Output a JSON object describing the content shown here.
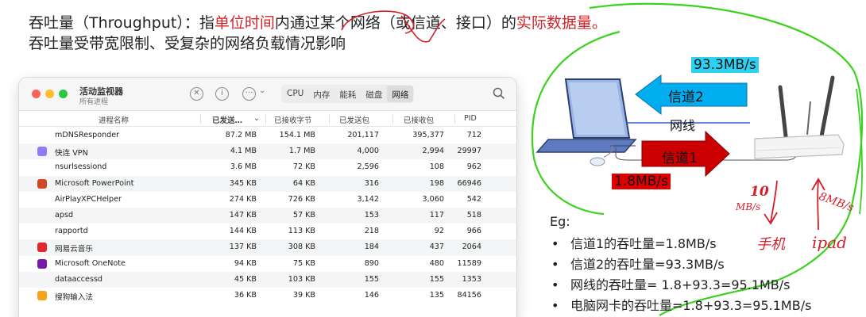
{
  "heading": {
    "line1_pre": "吞吐量（Throughput）：指",
    "line1_red1": "单位时间",
    "line1_mid": "内通过某个网络（或信道、接口）的",
    "line1_red2": "实际数据量",
    "line1_end": "。",
    "line2": "吞吐量受带宽限制、受复杂的网络负载情况影响"
  },
  "monitor": {
    "title": "活动监视器",
    "subtitle": "所有进程",
    "tabs": [
      "CPU",
      "内存",
      "能耗",
      "磁盘",
      "网络"
    ],
    "active_tab": "网络",
    "columns": {
      "name": "进程名称",
      "sent": "已发送…",
      "received": "已接收字节",
      "packets_in": "已发送包",
      "packets_out": "已接收包",
      "pid": "PID"
    },
    "rows": [
      {
        "name": "mDNSResponder",
        "sent": "87.2 MB",
        "received": "154.1 MB",
        "pin": "201,117",
        "pout": "395,377",
        "pid": "712",
        "icon": "none"
      },
      {
        "name": "快连 VPN",
        "sent": "4.1 MB",
        "received": "1.7 MB",
        "pin": "4,000",
        "pout": "2,994",
        "pid": "29997",
        "icon": "vpn-icon"
      },
      {
        "name": "nsurlsessiond",
        "sent": "3.6 MB",
        "received": "72 KB",
        "pin": "2,596",
        "pout": "108",
        "pid": "962",
        "icon": "none"
      },
      {
        "name": "Microsoft PowerPoint",
        "sent": "345 KB",
        "received": "64 KB",
        "pin": "316",
        "pout": "198",
        "pid": "66946",
        "icon": "powerpoint-icon"
      },
      {
        "name": "AirPlayXPCHelper",
        "sent": "274 KB",
        "received": "726 KB",
        "pin": "3,142",
        "pout": "3,060",
        "pid": "542",
        "icon": "none"
      },
      {
        "name": "apsd",
        "sent": "147 KB",
        "received": "57 KB",
        "pin": "153",
        "pout": "117",
        "pid": "518",
        "icon": "none"
      },
      {
        "name": "rapportd",
        "sent": "144 KB",
        "received": "113 KB",
        "pin": "218",
        "pout": "92",
        "pid": "966",
        "icon": "none"
      },
      {
        "name": "网易云音乐",
        "sent": "137 KB",
        "received": "308 KB",
        "pin": "184",
        "pout": "437",
        "pid": "2064",
        "icon": "netease-music-icon"
      },
      {
        "name": "Microsoft OneNote",
        "sent": "94 KB",
        "received": "75 KB",
        "pin": "890",
        "pout": "480",
        "pid": "11589",
        "icon": "onenote-icon"
      },
      {
        "name": "dataaccessd",
        "sent": "45 KB",
        "received": "103 KB",
        "pin": "155",
        "pout": "155",
        "pid": "1353",
        "icon": "none"
      },
      {
        "name": "搜狗输入法",
        "sent": "36 KB",
        "received": "39 KB",
        "pin": "146",
        "pout": "135",
        "pid": "84156",
        "icon": "sogou-icon"
      }
    ]
  },
  "diagram": {
    "rate_top": "93.3MB/s",
    "channel2": "信道2",
    "cable": "网线",
    "channel1": "信道1",
    "rate_bottom": "1.8MB/s",
    "hand_left_num": "10",
    "hand_left_unit": "MB/s",
    "hand_right": "8MB/s",
    "hand_phone": "手机",
    "hand_ipad": "ipad",
    "colors": {
      "cyan": "#2dd2f2",
      "red": "#e00000",
      "green_ink": "#3bd21e",
      "red_ink": "#d0202a"
    }
  },
  "examples": {
    "title": "Eg:",
    "bullet": "•",
    "items": [
      "信道1的吞吐量=1.8MB/s",
      "信道2的吞吐量=93.3MB/s",
      "网线的吞吐量= 1.8+93.3=95.1MB/s",
      "电脑网卡的吞吐量=1.8+93.3=95.1MB/s"
    ]
  }
}
